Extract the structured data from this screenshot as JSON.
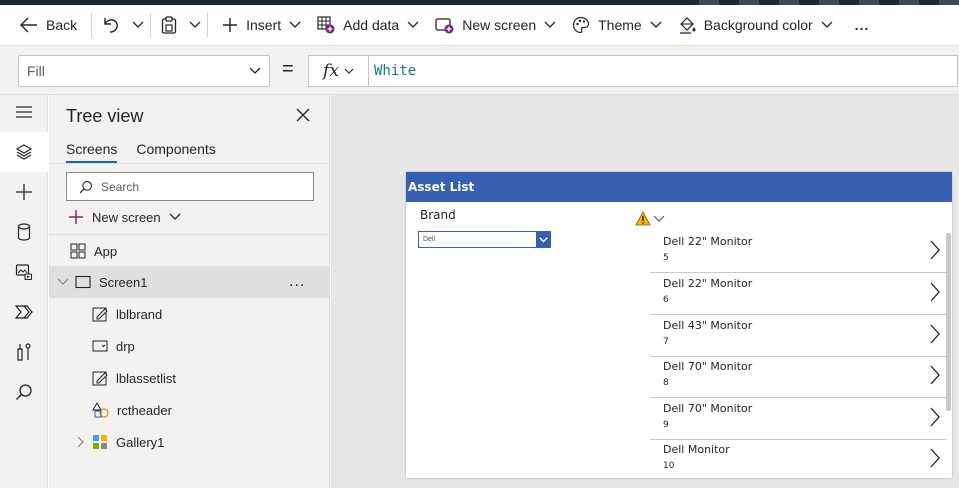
{
  "toolbar": {
    "back_label": "Back",
    "insert_label": "Insert",
    "add_data_label": "Add data",
    "new_screen_label": "New screen",
    "theme_label": "Theme",
    "background_color_label": "Background color",
    "more_label": "..."
  },
  "formula_bar": {
    "property": "Fill",
    "equals": "=",
    "fx_label": "fx",
    "formula": "White"
  },
  "rail": {
    "icons": [
      "hamburger-icon",
      "layers-icon",
      "add-icon",
      "database-icon",
      "media-icon",
      "power-automate-icon",
      "tools-icon",
      "search-icon"
    ],
    "active_index": 1
  },
  "tree_view": {
    "title": "Tree view",
    "tabs": [
      "Screens",
      "Components"
    ],
    "active_tab": 0,
    "search_placeholder": "Search",
    "new_screen_label": "New screen",
    "nodes": [
      {
        "label": "App",
        "icon": "app-icon"
      },
      {
        "label": "Screen1",
        "icon": "screen-icon",
        "selected": true,
        "more": "..."
      },
      {
        "label": "lblbrand",
        "icon": "label-icon"
      },
      {
        "label": "drp",
        "icon": "dropdown-icon"
      },
      {
        "label": "lblassetlist",
        "icon": "label-icon"
      },
      {
        "label": "rctheader",
        "icon": "shape-icon"
      },
      {
        "label": "Gallery1",
        "icon": "gallery-icon"
      }
    ]
  },
  "app_screen": {
    "header_title": "Asset List",
    "header_color": "#3860b2",
    "brand_label": "Brand",
    "dropdown_value": "Dell",
    "gallery_items": [
      {
        "title": "Dell 22\" Monitor",
        "subtitle": "5"
      },
      {
        "title": "Dell 22\" Monitor",
        "subtitle": "6"
      },
      {
        "title": "Dell 43\" Monitor",
        "subtitle": "7"
      },
      {
        "title": "Dell 70\" Monitor",
        "subtitle": "8"
      },
      {
        "title": "Dell 70\" Monitor",
        "subtitle": "9"
      },
      {
        "title": "Dell Monitor",
        "subtitle": "10"
      }
    ]
  },
  "colors": {
    "accent": "#0f6cbd",
    "brand_purple": "#742774",
    "warning": "#f2b705"
  }
}
